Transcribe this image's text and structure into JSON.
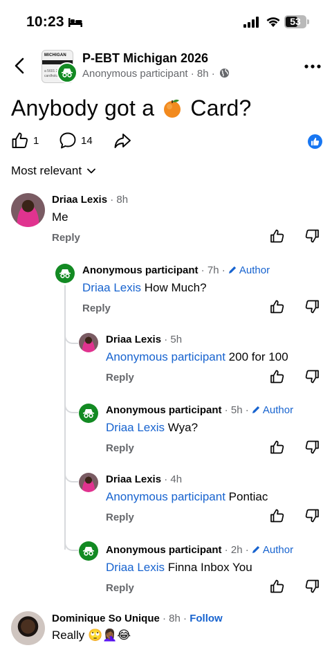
{
  "status_bar": {
    "time": "10:23",
    "battery": "53"
  },
  "header": {
    "group_name": "P-EBT Michigan 2026",
    "subtitle": "Anonymous participant · 8h ·",
    "thumb_text": "MICHIGAN",
    "thumb_line": "a 5601 2",
    "thumb_line2": "cardholder"
  },
  "post": {
    "title_before": "Anybody got a",
    "title_emoji": "orange",
    "title_after": "Card?",
    "like_count": "1",
    "comment_count": "14"
  },
  "sort_label": "Most relevant",
  "comments": [
    {
      "name": "Driaa Lexis",
      "meta": " · 8h",
      "text": "Me",
      "reply": "Reply"
    },
    {
      "name": "Anonymous participant",
      "meta": " · 7h · ",
      "author": "Author",
      "mention": "Driaa Lexis",
      "text": " How Much?",
      "reply": "Reply"
    },
    {
      "name": "Driaa Lexis",
      "meta": " · 5h",
      "mention": "Anonymous participant",
      "text": " 200 for 100",
      "reply": "Reply"
    },
    {
      "name": "Anonymous participant",
      "meta": " · 5h · ",
      "author": "Author",
      "mention": "Driaa Lexis",
      "text": " Wya?",
      "reply": "Reply"
    },
    {
      "name": "Driaa Lexis",
      "meta": " · 4h",
      "mention": "Anonymous participant",
      "text": " Pontiac",
      "reply": "Reply"
    },
    {
      "name": "Anonymous participant",
      "meta": " · 2h · ",
      "author": "Author",
      "mention": "Driaa Lexis",
      "text": " Finna Inbox You",
      "reply": "Reply"
    },
    {
      "name": "Dominique So Unique",
      "meta": " · 8h · ",
      "follow": "Follow",
      "text": "Really 🙄🤦🏾‍♀️😂"
    }
  ]
}
